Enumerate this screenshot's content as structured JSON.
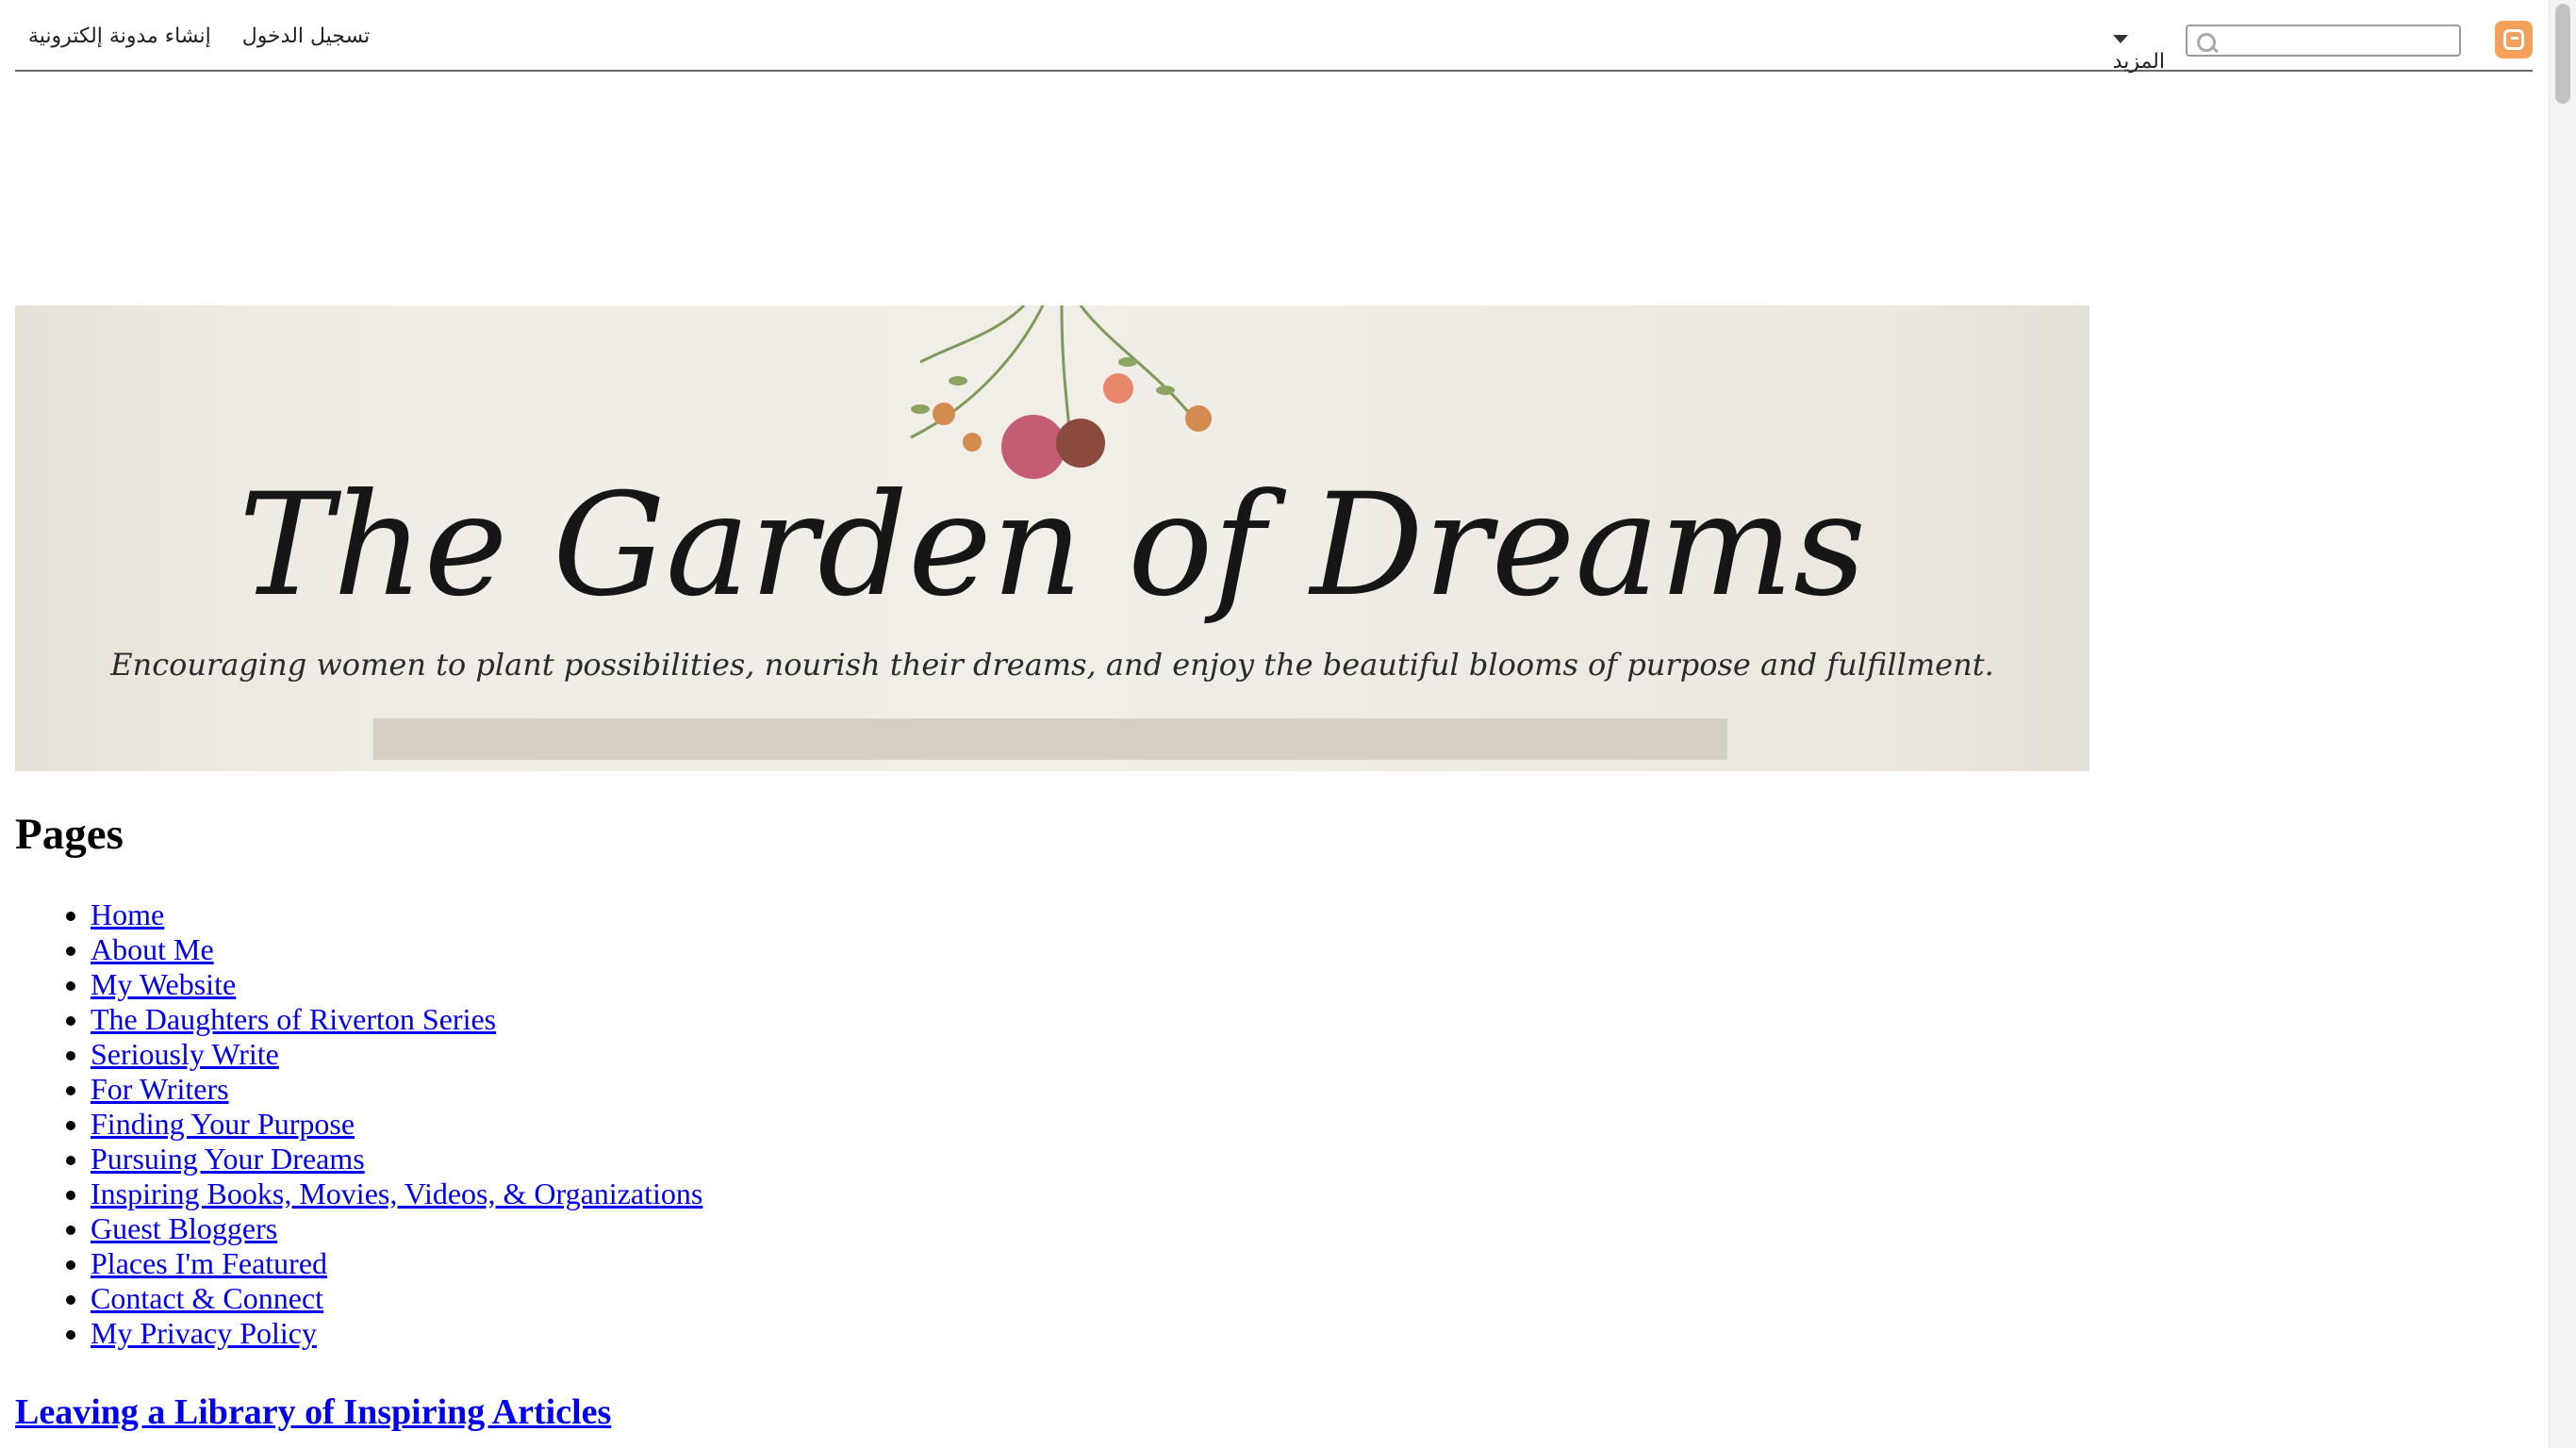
{
  "navbar": {
    "signin_label": "تسجيل الدخول",
    "create_blog_label": "إنشاء مدونة إلكترونية",
    "more_label": "المزيد",
    "search_placeholder": "",
    "logo_icon": "blogger-logo-icon",
    "accent_color": "#f5a05a"
  },
  "header": {
    "title": "The Garden of Dreams",
    "tagline": "Encouraging women to plant possibilities, nourish their dreams, and enjoy the beautiful blooms of purpose and fulfillment."
  },
  "pages": {
    "heading": "Pages",
    "items": [
      "Home",
      "About Me",
      "My Website",
      "The Daughters of Riverton Series",
      "Seriously Write",
      "For Writers",
      "Finding Your Purpose",
      "Pursuing Your Dreams",
      "Inspiring Books, Movies, Videos, & Organizations",
      "Guest Bloggers",
      "Places I'm Featured",
      "Contact & Connect",
      "My Privacy Policy"
    ]
  },
  "post": {
    "title": "Leaving a Library of Inspiring Articles"
  }
}
